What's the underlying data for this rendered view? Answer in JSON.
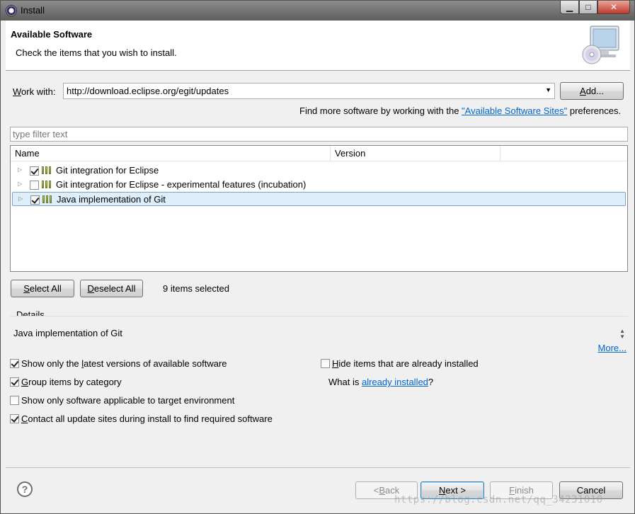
{
  "window": {
    "title": "Install",
    "controls": {
      "minimize": "▁",
      "maximize": "□",
      "close": "✕"
    },
    "close_color": "#c0392b"
  },
  "header": {
    "title": "Available Software",
    "description": "Check the items that you wish to install.",
    "banner_icon": "computer-cd-icon"
  },
  "work_with": {
    "label_prefix": "W",
    "label_rest": "ork with:",
    "value": "http://download.eclipse.org/egit/updates",
    "add_prefix": "A",
    "add_rest": "dd..."
  },
  "find_more": {
    "before": "Find more software by working with the ",
    "link": "\"Available Software Sites\"",
    "after": " preferences."
  },
  "filter": {
    "placeholder": "type filter text"
  },
  "tree": {
    "columns": [
      "Name",
      "Version"
    ],
    "rows": [
      {
        "label": "Git integration for Eclipse",
        "checked": true,
        "selected": false
      },
      {
        "label": "Git integration for Eclipse - experimental features  (incubation)",
        "checked": false,
        "selected": false
      },
      {
        "label": "Java implementation of Git",
        "checked": true,
        "selected": true
      }
    ]
  },
  "selection": {
    "select_all_prefix": "S",
    "select_all_rest": "elect All",
    "deselect_all_prefix": "D",
    "deselect_all_rest": "eselect All",
    "status": "9 items selected"
  },
  "details": {
    "label": "Details",
    "text": "Java implementation of Git",
    "more": "More..."
  },
  "options": {
    "latest_before": "Show only the ",
    "latest_u": "l",
    "latest_after": "atest versions of available software",
    "latest_checked": true,
    "group_u": "G",
    "group_rest": "roup items by category",
    "group_checked": true,
    "applicable": "Show only software applicable to target environment",
    "applicable_checked": false,
    "contact_u": "C",
    "contact_rest": "ontact all update sites during install to find required software",
    "contact_checked": true,
    "hide_u": "H",
    "hide_rest": "ide items that are already installed",
    "hide_checked": false,
    "what_is_before": "What is ",
    "what_is_link": "already installed",
    "what_is_after": "?"
  },
  "footer": {
    "back_before": "< ",
    "back_u": "B",
    "back_rest": "ack",
    "next_u": "N",
    "next_rest": "ext >",
    "finish_u": "F",
    "finish_rest": "inish",
    "cancel": "Cancel"
  },
  "watermark": "https://blog.csdn.net/qq_34231010"
}
